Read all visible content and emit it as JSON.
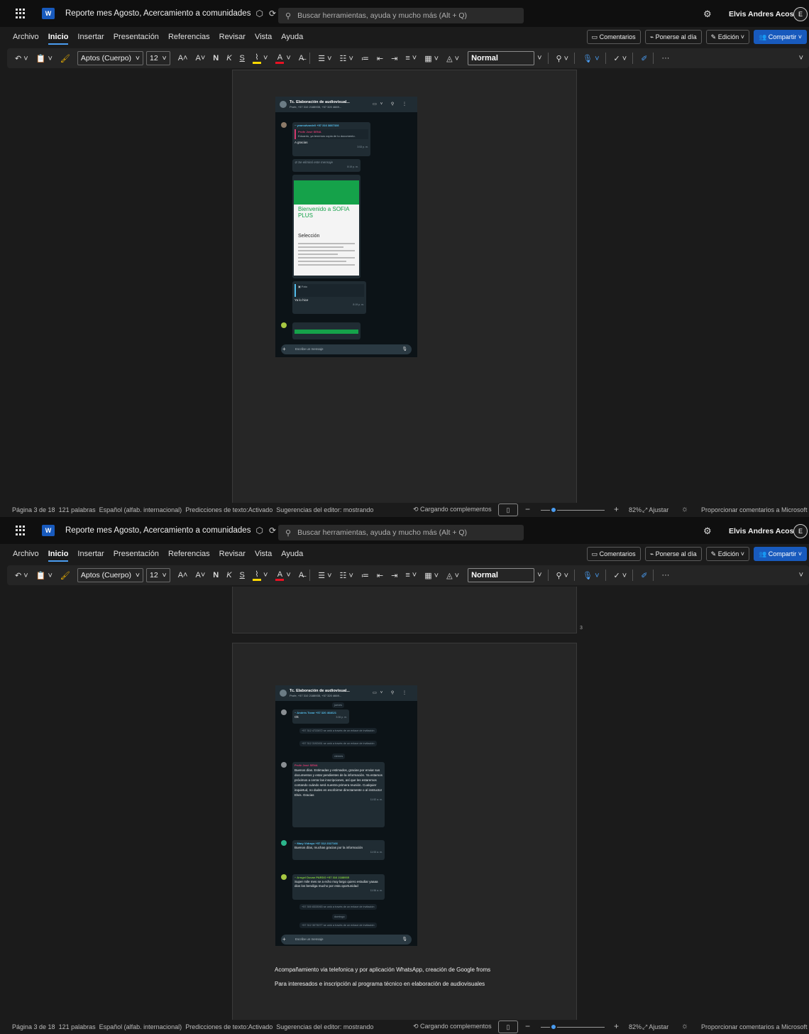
{
  "app": {
    "doc_title": "Reporte mes Agosto, Acercamiento a comunidades",
    "app_letter": "W",
    "search_placeholder": "Buscar herramientas, ayuda y mucho más (Alt + Q)",
    "user_name": "Elvis Andres Acost...",
    "avatar_initial": "E"
  },
  "menu": {
    "items": [
      "Archivo",
      "Inicio",
      "Insertar",
      "Presentación",
      "Referencias",
      "Revisar",
      "Vista",
      "Ayuda"
    ],
    "active": "Inicio",
    "buttons": {
      "comments": "Comentarios",
      "catchup": "Ponerse al día",
      "editing": "Edición",
      "share": "Compartir"
    }
  },
  "ribbon": {
    "font_name": "Aptos (Cuerpo)",
    "font_size": "12",
    "bold": "N",
    "italic": "K",
    "underline": "S",
    "style": "Normal",
    "grow": "A",
    "shrink": "A"
  },
  "status": {
    "page": "Página 3 de 18",
    "words": "121 palabras",
    "language": "Español (alfab. internacional)",
    "predictions": "Predicciones de texto:Activado",
    "suggestions": "Sugerencias del editor: mostrando",
    "loading": "Cargando complementos",
    "zoom": "82%",
    "fit": "Ajustar",
    "feedback": "Proporcionar comentarios a Microsoft",
    "zoom_level": 0.82
  },
  "document": {
    "page_number": "3",
    "line1": "Acompañamiento via telefonica y por aplicación WhatsApp, creación de Google froms",
    "line2": "Para interesados e inscripción al programa técnico en elaboración de audiovisuales"
  },
  "phone1": {
    "chat_title": "Tc. Elaboración de audiovisual...",
    "chat_sub": "Profe, +57 310 2188935, +57 320 4669...",
    "msg1_name": "~ yeansdvarde0 +57 316 3887328",
    "msg1_quote_name": "Profe José SENA",
    "msg1_quote": "Eduardo, ya tenemos copia de tu documento.",
    "msg1_text": "A gracias",
    "msg1_time": "3:53 p. m.",
    "msg2_text": "Se eliminó este mensaje",
    "msg2_time": "8:19 p. m.",
    "sofia_title": "Bienvenido a SOFIA PLUS",
    "sofia_sub": "Selección",
    "msg3_text": "Ya lo hice",
    "msg3_time": "8:19 p. m.",
    "msg3_photo": "Foto",
    "input": "Escribe un mensaje"
  },
  "phone2": {
    "chat_title": "Tc. Elaboración de audiovisual...",
    "chat_sub": "Profe, +57 310 2188935, +57 320 4669...",
    "day1": "jueves",
    "day2": "viernes",
    "day3": "domingo",
    "m1_name": "~ Andrés Tovar +57 320 464621",
    "m1_text": "Ok",
    "m1_time": "3:06 p. m.",
    "sys1": "+57 312 4722872 se unió a través de un enlace de invitación",
    "sys2": "+57 312 3192451 se unió a través de un enlace de invitación",
    "m2_name": "Profe José SENA",
    "m2_text": "Buenos días. Estimadas y estimados, gracias por enviar sus documentos y estar pendientes de la información. Ya estamos próximos a cerrar las inscripciones, así que les estaremos contando cuándo será nuestra primera reunión. Cualquier inquietud, no dudes en escribirme directamente o al instructor Elvis. Gracias",
    "m2_time": "11:52 a. m.",
    "m3_name": "~ Mary Vidrayo +57 312 2327166",
    "m3_text": "Buenos días, muchas gracias por la información",
    "m3_time": "11:53 a. m.",
    "m4_name": "~ Arngel Duvan PARDO +57 316 2188935",
    "m4_text": "Super mile mes se a echo muy largo quiero estudiar yaaaa dios los bendiga mucho por esta oportunidad",
    "m4_time": "11:56 a. m.",
    "sys3": "+57 300 8333063 se unió a través de un enlace de invitación",
    "sys4": "+57 312 3073077 se unió a través de un enlace de invitación",
    "input": "Escribe un mensaje"
  },
  "colors": {
    "accent": "#185abd",
    "active_tab": "#4a9cf0",
    "whatsapp_bg": "#0c1317",
    "sofia_green": "#15a24a"
  }
}
